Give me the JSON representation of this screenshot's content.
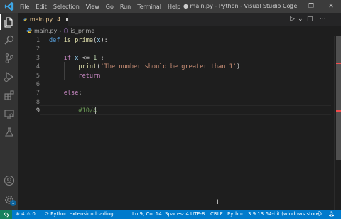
{
  "menu": [
    "File",
    "Edit",
    "Selection",
    "View",
    "Go",
    "Run",
    "Terminal",
    "Help"
  ],
  "window_title": "● main.py - Python - Visual Studio Code",
  "tab": {
    "name": "main.py",
    "problems": "4"
  },
  "breadcrumb": {
    "file": "main.py",
    "symbol": "is_prime"
  },
  "code_lines": [
    {
      "n": "1",
      "parts": [
        [
          "kw",
          "def"
        ],
        [
          "op",
          " "
        ],
        [
          "fn",
          "is_prime"
        ],
        [
          "op",
          "("
        ],
        [
          "id",
          "x"
        ],
        [
          "op",
          "):"
        ]
      ]
    },
    {
      "n": "2",
      "parts": []
    },
    {
      "n": "3",
      "parts": [
        [
          "op",
          "    "
        ],
        [
          "kw2",
          "if"
        ],
        [
          "op",
          " "
        ],
        [
          "id",
          "x"
        ],
        [
          "op",
          " <= "
        ],
        [
          "num",
          "1"
        ],
        [
          "op",
          " :"
        ]
      ]
    },
    {
      "n": "4",
      "parts": [
        [
          "op",
          "        "
        ],
        [
          "fn",
          "print"
        ],
        [
          "op",
          "("
        ],
        [
          "str",
          "'The number should be greater than 1'"
        ],
        [
          "op",
          ")"
        ]
      ]
    },
    {
      "n": "5",
      "parts": [
        [
          "op",
          "        "
        ],
        [
          "kw2",
          "return"
        ]
      ]
    },
    {
      "n": "6",
      "parts": []
    },
    {
      "n": "7",
      "parts": [
        [
          "op",
          "    "
        ],
        [
          "kw2",
          "else"
        ],
        [
          "op",
          ":"
        ]
      ]
    },
    {
      "n": "8",
      "parts": []
    },
    {
      "n": "9",
      "parts": [
        [
          "op",
          "        "
        ],
        [
          "cm",
          "#10/4"
        ]
      ]
    }
  ],
  "status": {
    "errors": "4",
    "warnings": "0",
    "loading": "Python extension loading...",
    "position": "Ln 9, Col 14",
    "spaces": "Spaces: 4",
    "encoding": "UTF-8",
    "eol": "CRLF",
    "language": "Python",
    "interpreter": "3.9.13 64-bit (windows store)"
  },
  "badges": {
    "settings": "1"
  },
  "colors": {
    "statusbar": "#007acc",
    "accent": "#0e639c"
  },
  "icons": [
    "vscode-logo",
    "explorer-icon",
    "search-icon",
    "source-control-icon",
    "run-debug-icon",
    "extensions-icon",
    "remote-explorer-icon",
    "testing-icon",
    "account-icon",
    "settings-gear-icon"
  ]
}
